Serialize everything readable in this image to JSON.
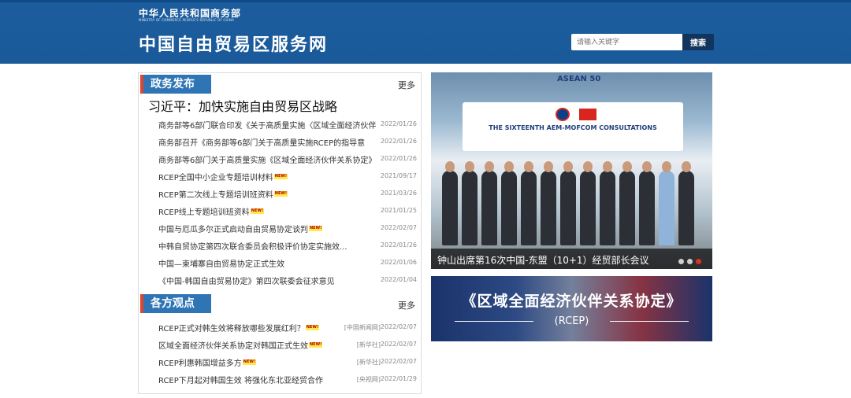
{
  "header": {
    "ministry_cn": "中华人民共和国商务部",
    "ministry_en": "MINISTRY OF COMMERCE PEOPLE'S REPUBLIC OF CHINA",
    "site_title": "中国自由贸易区服务网",
    "search_placeholder": "请输入关键字",
    "search_button": "搜索"
  },
  "gov_news": {
    "tab_label": "政务发布",
    "more_label": "更多",
    "headline": "习近平：加快实施自由贸易区战略",
    "items": [
      {
        "title": "商务部等6部门联合印发《关于高质量实施〈区域全面经济伙伴",
        "date": "2022/01/26",
        "new": false
      },
      {
        "title": "商务部召开《商务部等6部门关于高质量实施RCEP的指导意",
        "date": "2022/01/26",
        "new": false
      },
      {
        "title": "商务部等6部门关于高质量实施《区域全面经济伙伴关系协定》",
        "date": "2022/01/26",
        "new": false
      },
      {
        "title": "RCEP全国中小企业专题培训材料",
        "date": "2021/09/17",
        "new": true
      },
      {
        "title": "RCEP第二次线上专题培训班资料",
        "date": "2021/03/26",
        "new": true
      },
      {
        "title": "RCEP线上专题培训班资料",
        "date": "2021/01/25",
        "new": true
      },
      {
        "title": "中国与厄瓜多尔正式启动自由贸易协定谈判",
        "date": "2022/02/07",
        "new": true
      },
      {
        "title": "中韩自贸协定第四次联合委员会积极评价协定实施效...",
        "date": "2022/01/26",
        "new": false
      },
      {
        "title": "中国—柬埔寨自由贸易协定正式生效",
        "date": "2022/01/06",
        "new": false
      },
      {
        "title": "《中国-韩国自由贸易协定》第四次联委会征求意见",
        "date": "2022/01/04",
        "new": false
      }
    ]
  },
  "opinions": {
    "tab_label": "各方观点",
    "more_label": "更多",
    "items": [
      {
        "title": "RCEP正式对韩生效将释放哪些发展红利？",
        "source": "[中国新闻网]",
        "date": "2022/02/07",
        "new": true
      },
      {
        "title": "区域全面经济伙伴关系协定对韩国正式生效",
        "source": "[新华社]",
        "date": "2022/02/07",
        "new": true
      },
      {
        "title": "RCEP利惠韩国增益多方",
        "source": "[新华社]",
        "date": "2022/02/07",
        "new": true
      },
      {
        "title": "RCEP下月起对韩国生效 将强化东北亚经贸合作",
        "source": "[央视网]",
        "date": "2022/01/29",
        "new": false
      }
    ]
  },
  "new_badge": "NEW!",
  "slideshow": {
    "banner_asean": "ASEAN 50",
    "banner_text": "THE SIXTEENTH AEM-MOFCOM CONSULTATIONS",
    "caption": "钟山出席第16次中国-东盟（10+1）经贸部长会议",
    "active_index": 3
  },
  "rcep_banner": {
    "title": "《区域全面经济伙伴关系协定》",
    "subtitle": "(RCEP)"
  },
  "colors": {
    "header_blue": "#1c5d9e",
    "tab_blue": "#2f75b5",
    "tab_accent_red": "#e0452e",
    "search_button_navy": "#12355e"
  }
}
